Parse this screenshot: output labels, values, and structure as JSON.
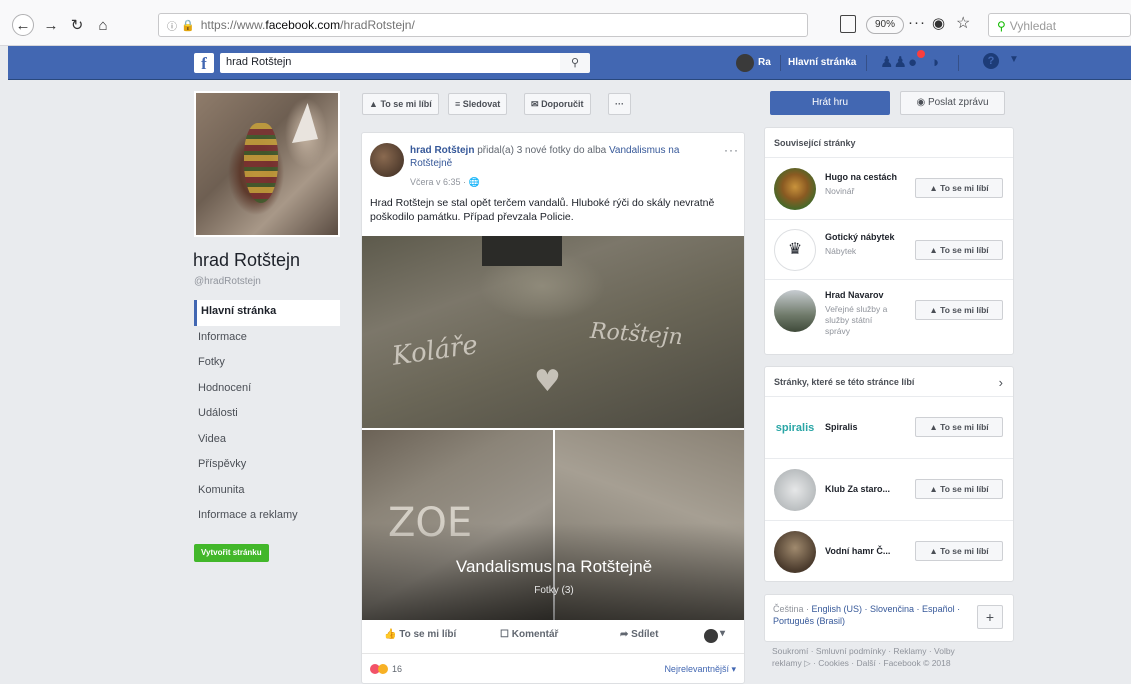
{
  "browser": {
    "url_prefix": "https://www.",
    "url_domain": "facebook.com",
    "url_path": "/hradRotstejn/",
    "zoom": "90%",
    "search_placeholder": "Vyhledat"
  },
  "fb_bar": {
    "logo": "f",
    "search_value": "hrad Rotštejn",
    "user_name": "Ra",
    "home_label": "Hlavní stránka"
  },
  "page": {
    "name": "hrad Rotštejn",
    "handle": "@hradRotstejn",
    "nav": [
      {
        "label": "Hlavní stránka"
      },
      {
        "label": "Informace"
      },
      {
        "label": "Fotky"
      },
      {
        "label": "Hodnocení"
      },
      {
        "label": "Události"
      },
      {
        "label": "Videa"
      },
      {
        "label": "Příspěvky"
      },
      {
        "label": "Komunita"
      },
      {
        "label": "Informace a reklamy"
      }
    ],
    "create_label": "Vytvořit stránku"
  },
  "actions": {
    "like": "To se mi líbí",
    "follow": "Sledovat",
    "recommend": "Doporučit",
    "more": "···",
    "play": "Hrát hru",
    "message": "Poslat zprávu"
  },
  "post": {
    "author": "hrad Rotštejn",
    "verb": " přidal(a) 3 nové fotky do alba ",
    "album": "Vandalismus na Rotštejně",
    "time": "Včera v 6:35 · ",
    "text": "Hrad Rotštejn se stal opět terčem vandalů. Hluboké rýči do skály nevratně poškodilo památku. Případ převzala Policie.",
    "album_title": "Vandalismus na Rotštejně",
    "album_sub": "Fotky (3)",
    "graffiti": [
      "Rotštejn",
      "ZOE"
    ],
    "like": "To se mi líbí",
    "comment": "Komentář",
    "share": "Sdílet",
    "reactions": "16",
    "sort": "Nejrelevantnější ▾"
  },
  "related": {
    "title": "Související stránky",
    "items": [
      {
        "name": "Hugo na cestách",
        "sub": "Novinář",
        "like": "To se mi líbí"
      },
      {
        "name": "Gotický nábytek",
        "sub": "Nábytek",
        "like": "To se mi líbí"
      },
      {
        "name": "Hrad Navarov",
        "sub": "Veřejné služby a služby státní správy",
        "like": "To se mi líbí"
      }
    ]
  },
  "liked": {
    "title": "Stránky, které se této stránce líbí",
    "items": [
      {
        "name": "Spiralis",
        "like": "To se mi líbí",
        "logo": "spiralis"
      },
      {
        "name": "Klub Za staro...",
        "like": "To se mi líbí"
      },
      {
        "name": "Vodní hamr Č...",
        "like": "To se mi líbí"
      }
    ]
  },
  "languages": {
    "current": "Čeština · ",
    "others": "English (US) · Slovenčina · Español · Português (Brasil)"
  },
  "footer": "Soukromí · Smluvní podmínky · Reklamy · Volby reklamy ▷ · Cookies · Další · Facebook © 2018"
}
